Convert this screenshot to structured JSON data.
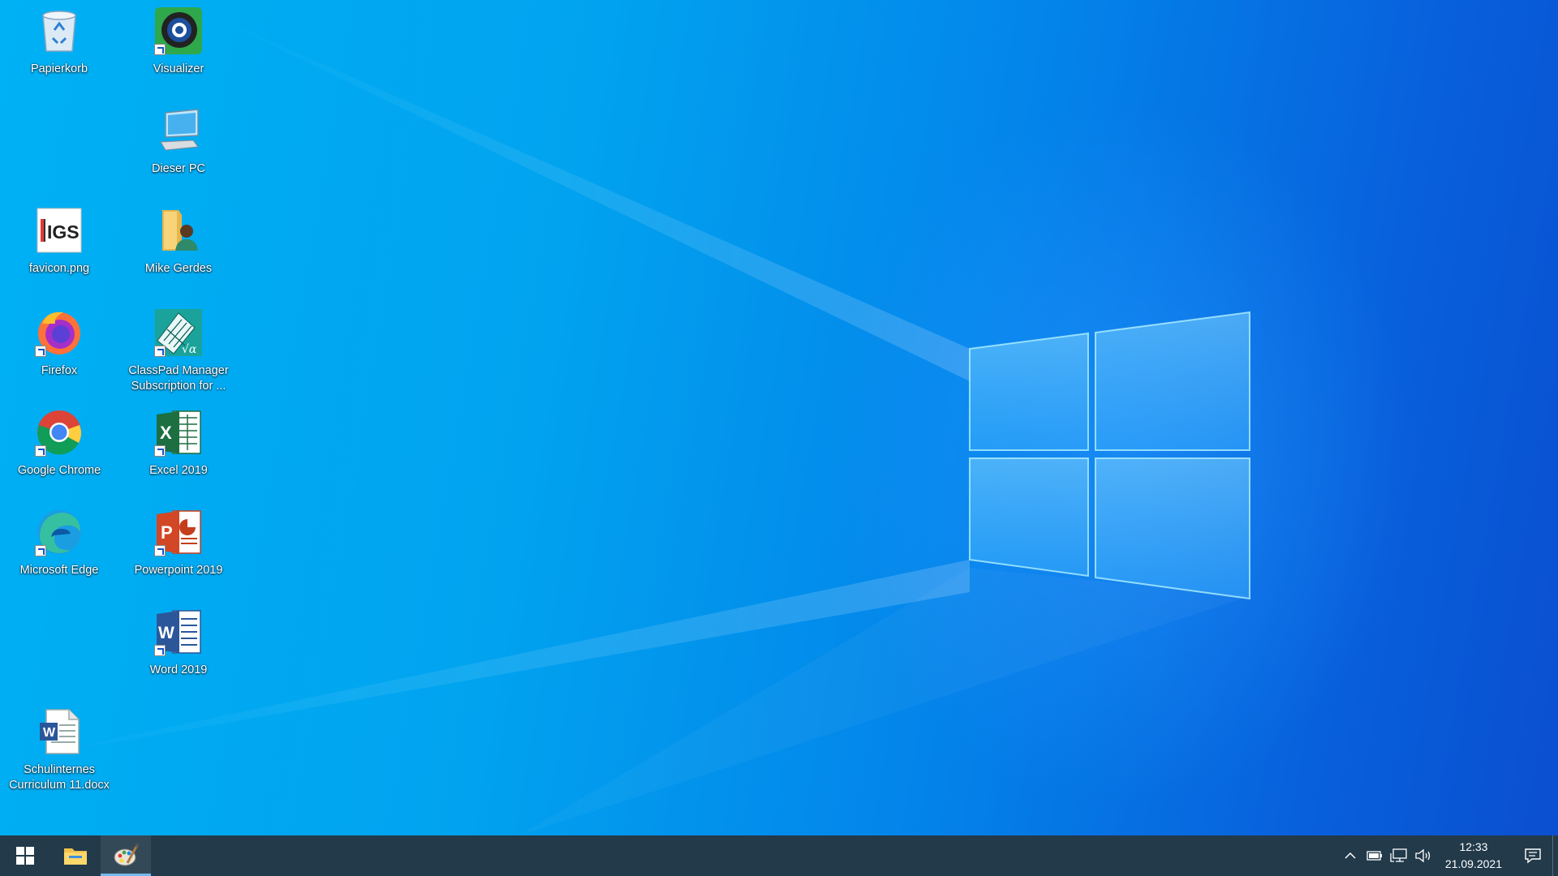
{
  "desktop_icons": [
    {
      "name": "papierkorb",
      "label": "Papierkorb",
      "icon": "recycle-bin-icon"
    },
    {
      "name": "visualizer",
      "label": "Visualizer",
      "icon": "visualizer-icon"
    },
    {
      "name": "dieser-pc",
      "label": "Dieser PC",
      "icon": "computer-icon"
    },
    {
      "name": "favicon-png",
      "label": "favicon.png",
      "icon": "igs-image-icon"
    },
    {
      "name": "mike-gerdes",
      "label": "Mike Gerdes",
      "icon": "user-folder-icon"
    },
    {
      "name": "firefox",
      "label": "Firefox",
      "icon": "firefox-icon"
    },
    {
      "name": "classpad-manager",
      "label": "ClassPad Manager Subscription for ...",
      "icon": "classpad-icon"
    },
    {
      "name": "google-chrome",
      "label": "Google Chrome",
      "icon": "chrome-icon"
    },
    {
      "name": "excel-2019",
      "label": "Excel 2019",
      "icon": "excel-icon"
    },
    {
      "name": "microsoft-edge",
      "label": "Microsoft Edge",
      "icon": "edge-icon"
    },
    {
      "name": "powerpoint-2019",
      "label": "Powerpoint 2019",
      "icon": "powerpoint-icon"
    },
    {
      "name": "word-2019",
      "label": "Word 2019",
      "icon": "word-icon"
    },
    {
      "name": "schulinternes-curriculum",
      "label": "Schulinternes Curriculum 11.docx",
      "icon": "word-document-icon"
    }
  ],
  "taskbar": {
    "start": "start-icon",
    "pinned": [
      {
        "name": "file-explorer",
        "icon": "folder-icon",
        "active": false
      },
      {
        "name": "paint",
        "icon": "paint-palette-icon",
        "active": true
      }
    ],
    "tray": {
      "time": "12:33",
      "date": "21.09.2021"
    }
  },
  "colors": {
    "taskbar": "#223a4a",
    "wallpaper_light": "#00b1f4",
    "wallpaper_dark": "#0a4fd0",
    "active_indicator": "#76b9ed"
  }
}
